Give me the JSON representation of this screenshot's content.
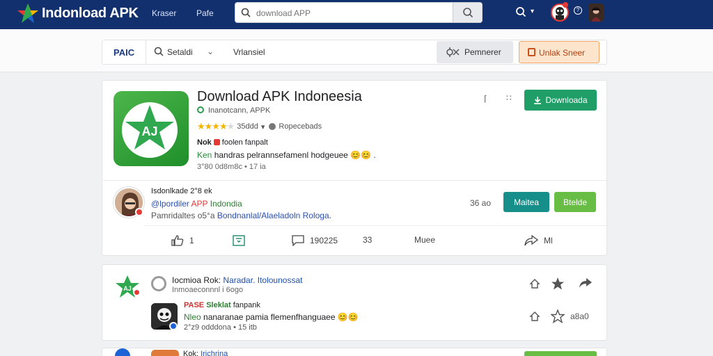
{
  "header": {
    "brand": "Indonload APK",
    "nav": [
      "Kraser",
      "Pafe"
    ],
    "search": {
      "placeholder": "download APP"
    }
  },
  "toolbar": {
    "brand_short": "PAIC",
    "select_label": "Setaldi",
    "version_label": "Vrlansiel",
    "preferences_label": "Pemnerer",
    "unlock_label": "Unlak Sneer"
  },
  "app_card": {
    "title": "Download APK Indoneesia",
    "publisher": "Inanotcann, APPK",
    "rating_label": "35ddd",
    "reviews_label": "Ropecebads",
    "tag_prefix": "Nok",
    "tag_text": "foolen fanpalt",
    "desc_keyword": "Ken",
    "desc_text": "handras pelrannsefamenl hodgeuee 😊😊 .",
    "meta": "3°80 0d8m8c • 17 ia",
    "download_label": "Downloada",
    "post": {
      "name": "Isdonlkade 2°8 ek",
      "handle_prefix": "@lpordiler",
      "handle_app": "APP",
      "handle_tail": "Indondia",
      "line_prefix": "Pamridaltes o5°a",
      "line_tags": "Bondnanlal/Alaeladoln Rologa.",
      "stat": "36 ao",
      "btn_teal": "Maitea",
      "btn_green": "Btelde"
    },
    "actions": [
      {
        "label": "1"
      },
      {
        "label": ""
      },
      {
        "label": "190225"
      },
      {
        "label": "33"
      },
      {
        "label": "Muee"
      },
      {
        "label": "Ml"
      }
    ]
  },
  "feed_card": {
    "title_prefix": "Iocmioa Rok:",
    "title_highlight": "Naradar. Itolounossat",
    "subtitle": "Inmoaeconnnl i 6ogo",
    "tag_red": "PASE",
    "tag_green": "Sleklat",
    "tag_tail": "fanpank",
    "desc_keyword": "Nleo",
    "desc_text": "nanaranae pamia flemenfhanguaee 😊😊",
    "meta": "2°z9 odddona • 15 itb",
    "count_label": "a8a0"
  },
  "third_card": {
    "title_prefix": "Kok:",
    "title_tail": "Irichrina"
  },
  "colors": {
    "header_bg": "#13306e",
    "download_green": "#1f9e68",
    "teal": "#168f8a",
    "light_green": "#68bd45",
    "unlock_orange": "#fde4cc"
  }
}
